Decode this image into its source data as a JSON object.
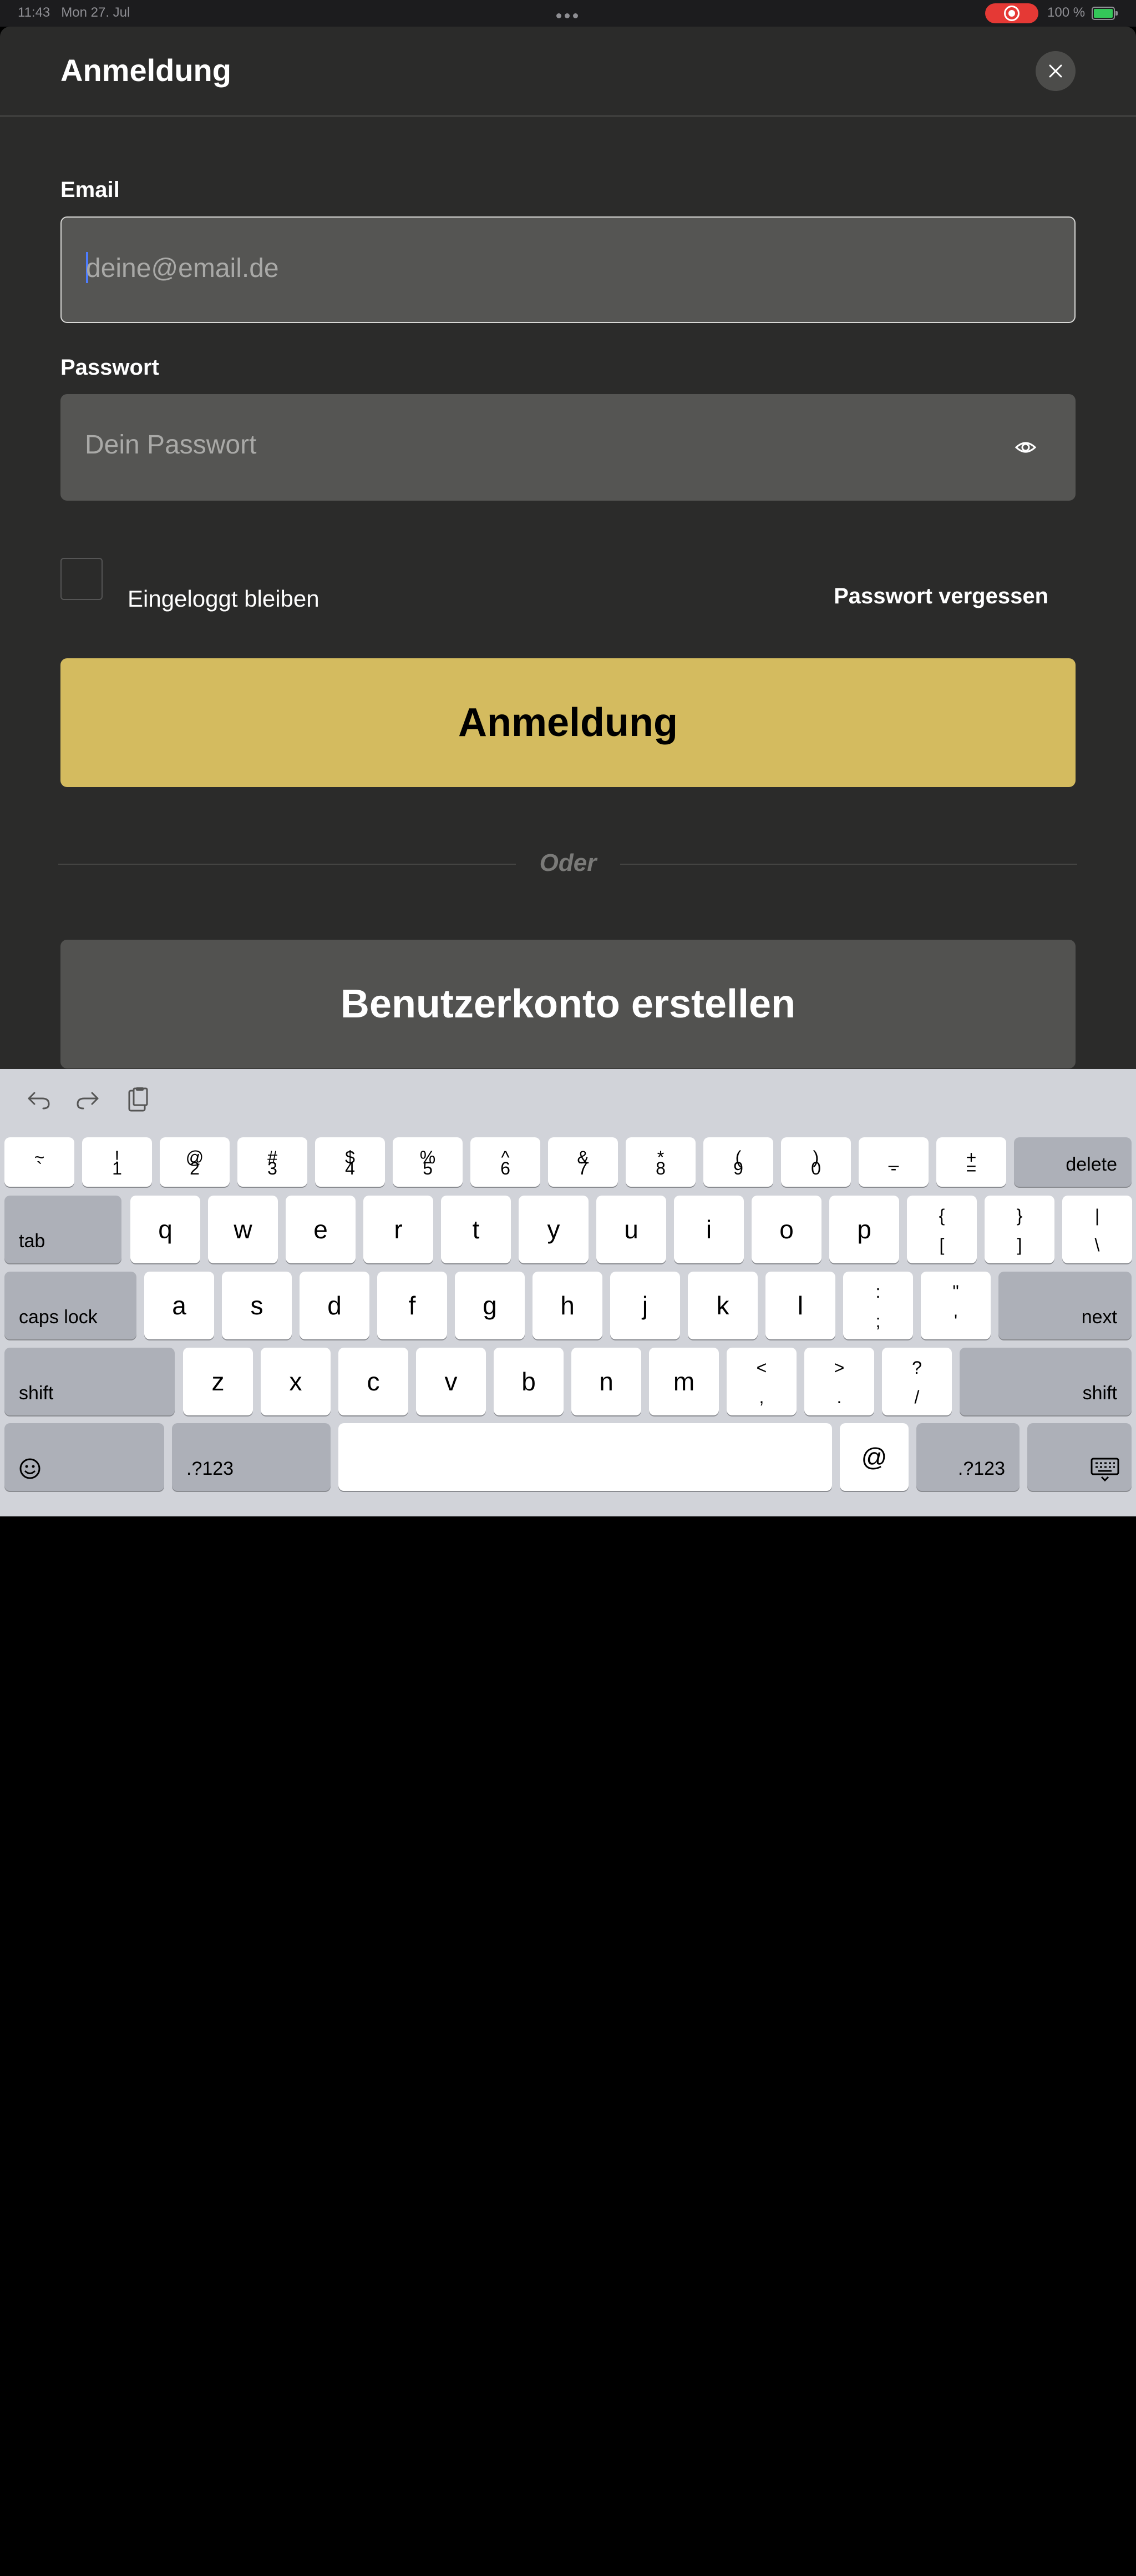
{
  "status_bar": {
    "time": "11:43",
    "date": "Mon 27. Jul",
    "battery": "100 %"
  },
  "sheet": {
    "title": "Anmeldung",
    "close_icon": "close-icon"
  },
  "form": {
    "email_label": "Email",
    "email_placeholder": "deine@email.de",
    "password_label": "Passwort",
    "password_placeholder": "Dein Passwort",
    "remember_label": "Eingeloggt bleiben",
    "forgot_label": "Passwort vergessen",
    "login_button": "Anmeldung",
    "or_text": "Oder",
    "create_account_button": "Benutzerkonto erstellen"
  },
  "colors": {
    "accent": "#d4bb5f",
    "background": "#2b2b2a",
    "input": "#555553"
  },
  "keyboard": {
    "row1": [
      [
        "~",
        "`"
      ],
      [
        "!",
        "1"
      ],
      [
        "@",
        "2"
      ],
      [
        "#",
        "3"
      ],
      [
        "$",
        "4"
      ],
      [
        "%",
        "5"
      ],
      [
        "^",
        "6"
      ],
      [
        "&",
        "7"
      ],
      [
        "*",
        "8"
      ],
      [
        "(",
        "9"
      ],
      [
        ")",
        "0"
      ],
      [
        "_",
        "-"
      ],
      [
        "+",
        "="
      ]
    ],
    "delete": "delete",
    "tab": "tab",
    "row2": [
      "q",
      "w",
      "e",
      "r",
      "t",
      "y",
      "u",
      "i",
      "o",
      "p"
    ],
    "row2_sym": [
      [
        "{",
        "["
      ],
      [
        "}",
        "]"
      ],
      [
        "|",
        "\\"
      ]
    ],
    "caps": "caps lock",
    "row3": [
      "a",
      "s",
      "d",
      "f",
      "g",
      "h",
      "j",
      "k",
      "l"
    ],
    "row3_sym": [
      [
        ":",
        ";"
      ],
      [
        "\"",
        "'"
      ]
    ],
    "next": "next",
    "shift": "shift",
    "row4": [
      "z",
      "x",
      "c",
      "v",
      "b",
      "n",
      "m"
    ],
    "row4_sym": [
      [
        "<",
        ","
      ],
      [
        ">",
        "."
      ],
      [
        "?",
        "/"
      ]
    ],
    "numbers": ".?123",
    "at": "@"
  }
}
